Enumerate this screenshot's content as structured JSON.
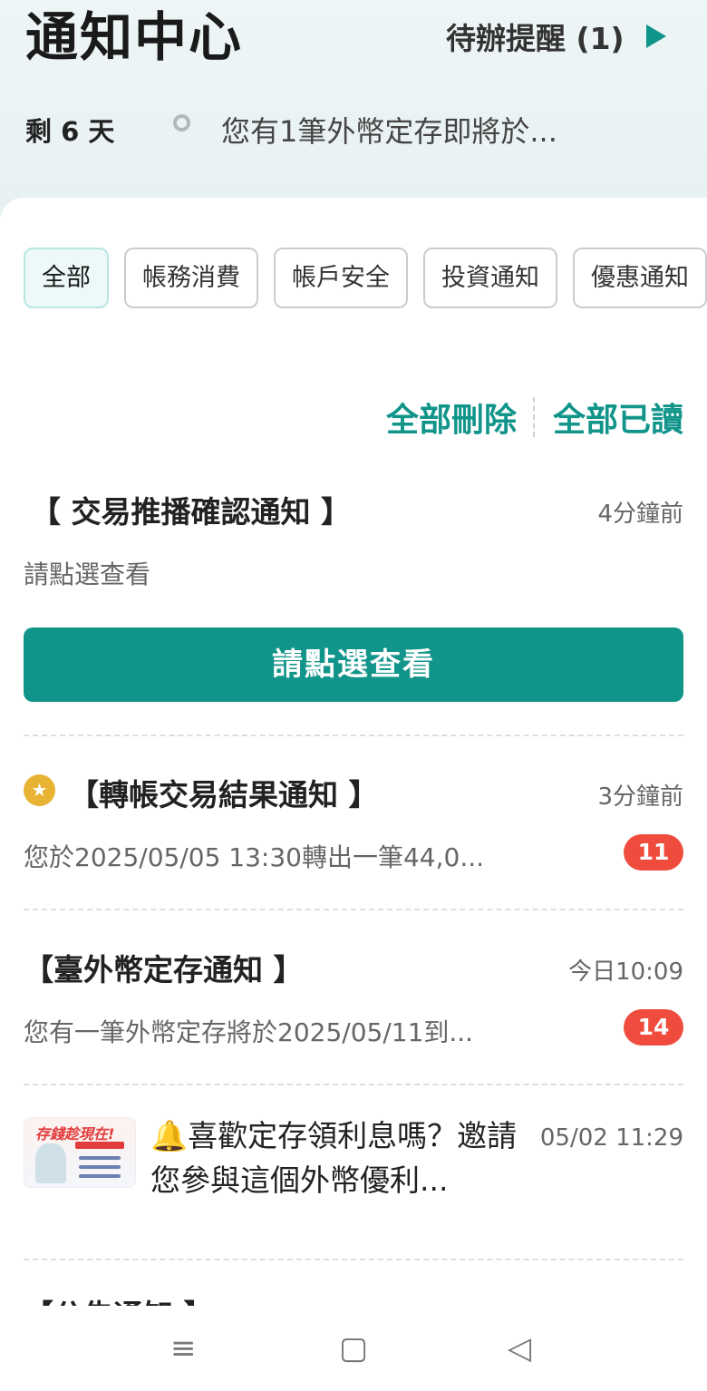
{
  "header": {
    "title": "通知中心",
    "todo_label": "待辦提醒 (1)",
    "days_left": "剩 6 天",
    "todo_text": "您有1筆外幣定存即將於..."
  },
  "tabs": [
    {
      "label": "全部",
      "active": true
    },
    {
      "label": "帳務消費",
      "active": false
    },
    {
      "label": "帳戶安全",
      "active": false
    },
    {
      "label": "投資通知",
      "active": false
    },
    {
      "label": "優惠通知",
      "active": false
    }
  ],
  "actions": {
    "delete_all": "全部刪除",
    "read_all": "全部已讀"
  },
  "notifications": [
    {
      "title": "【 交易推播確認通知 】",
      "time": "4分鐘前",
      "body": "請點選查看",
      "button": "請點選查看"
    },
    {
      "title": "【轉帳交易結果通知 】",
      "time": "3分鐘前",
      "body": "您於2025/05/05 13:30轉出一筆44,0...",
      "badge": "11",
      "pinned": true
    },
    {
      "title": "【臺外幣定存通知 】",
      "time": "今日10:09",
      "body": "您有一筆外幣定存將於2025/05/11到...",
      "badge": "14"
    },
    {
      "title": "🔔喜歡定存領利息嗎？邀請您參與這個外幣優利...",
      "time": "05/02 11:29",
      "image_title": "存錢趁現在!"
    }
  ],
  "partial_next_title": "【公告通知 】",
  "colors": {
    "accent": "#11958a",
    "badge": "#f04c3e",
    "pin": "#e8b233"
  },
  "navbar": {
    "menu_icon": "≡",
    "home_icon": "▢",
    "back_icon": "◁"
  }
}
